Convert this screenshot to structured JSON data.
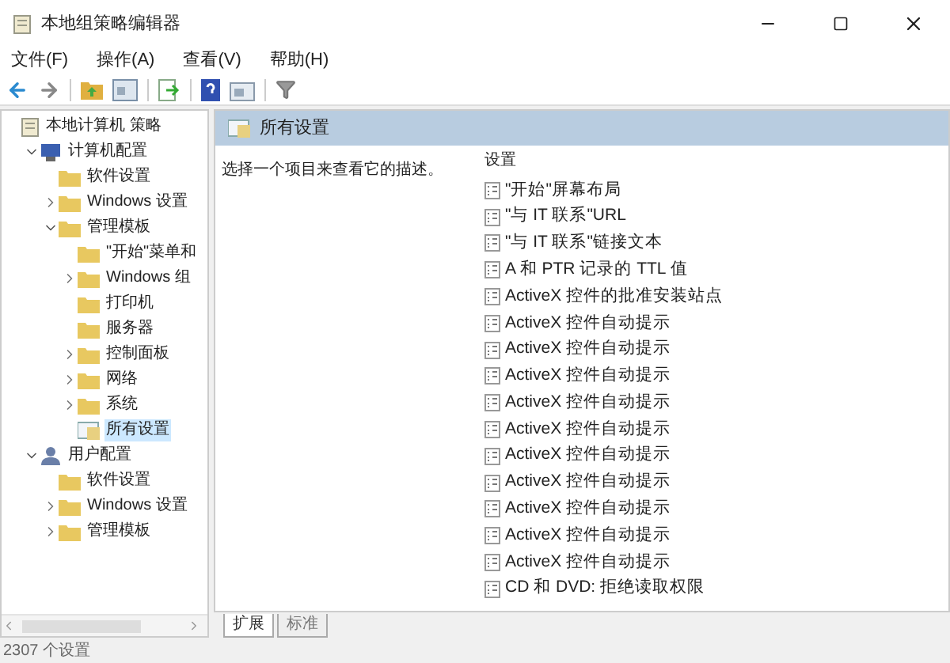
{
  "window": {
    "title": "本地组策略编辑器"
  },
  "menu": [
    "文件(F)",
    "操作(A)",
    "查看(V)",
    "帮助(H)"
  ],
  "tree": [
    {
      "label": "本地计算机 策略",
      "kind": "policy",
      "selected": false,
      "children": [
        {
          "label": "计算机配置",
          "kind": "computer",
          "selected": false,
          "expanded": true,
          "children": [
            {
              "label": "软件设置",
              "kind": "folder",
              "selected": false
            },
            {
              "label": "Windows 设置",
              "kind": "folder",
              "selected": false,
              "expanded": false
            },
            {
              "label": "管理模板",
              "kind": "folder",
              "selected": false,
              "expanded": true,
              "children": [
                {
                  "label": "\"开始\"菜单和",
                  "kind": "folder",
                  "selected": false
                },
                {
                  "label": "Windows 组",
                  "kind": "folder",
                  "selected": false,
                  "expanded": false
                },
                {
                  "label": "打印机",
                  "kind": "folder",
                  "selected": false
                },
                {
                  "label": "服务器",
                  "kind": "folder",
                  "selected": false
                },
                {
                  "label": "控制面板",
                  "kind": "folder",
                  "selected": false,
                  "expanded": false
                },
                {
                  "label": "网络",
                  "kind": "folder",
                  "selected": false,
                  "expanded": false
                },
                {
                  "label": "系统",
                  "kind": "folder",
                  "selected": false,
                  "expanded": false
                },
                {
                  "label": "所有设置",
                  "kind": "settings",
                  "selected": true
                }
              ]
            }
          ]
        },
        {
          "label": "用户配置",
          "kind": "user",
          "selected": false,
          "expanded": true,
          "children": [
            {
              "label": "软件设置",
              "kind": "folder",
              "selected": false
            },
            {
              "label": "Windows 设置",
              "kind": "folder",
              "selected": false,
              "expanded": false
            },
            {
              "label": "管理模板",
              "kind": "folder",
              "selected": false,
              "expanded": false
            }
          ]
        }
      ]
    }
  ],
  "panel": {
    "title": "所有设置",
    "description": "选择一个项目来查看它的描述。",
    "column": "设置",
    "items": [
      "\"开始\"屏幕布局",
      "\"与 IT 联系\"URL",
      "\"与 IT 联系\"链接文本",
      "A 和 PTR 记录的 TTL 值",
      "ActiveX 控件的批准安装站点",
      "ActiveX 控件自动提示",
      "ActiveX 控件自动提示",
      "ActiveX 控件自动提示",
      "ActiveX 控件自动提示",
      "ActiveX 控件自动提示",
      "ActiveX 控件自动提示",
      "ActiveX 控件自动提示",
      "ActiveX 控件自动提示",
      "ActiveX 控件自动提示",
      "ActiveX 控件自动提示",
      "CD 和 DVD: 拒绝读取权限"
    ]
  },
  "tabs": [
    {
      "label": "扩展",
      "selected": true
    },
    {
      "label": "标准",
      "selected": false
    }
  ],
  "status_bar": "2307 个设置"
}
